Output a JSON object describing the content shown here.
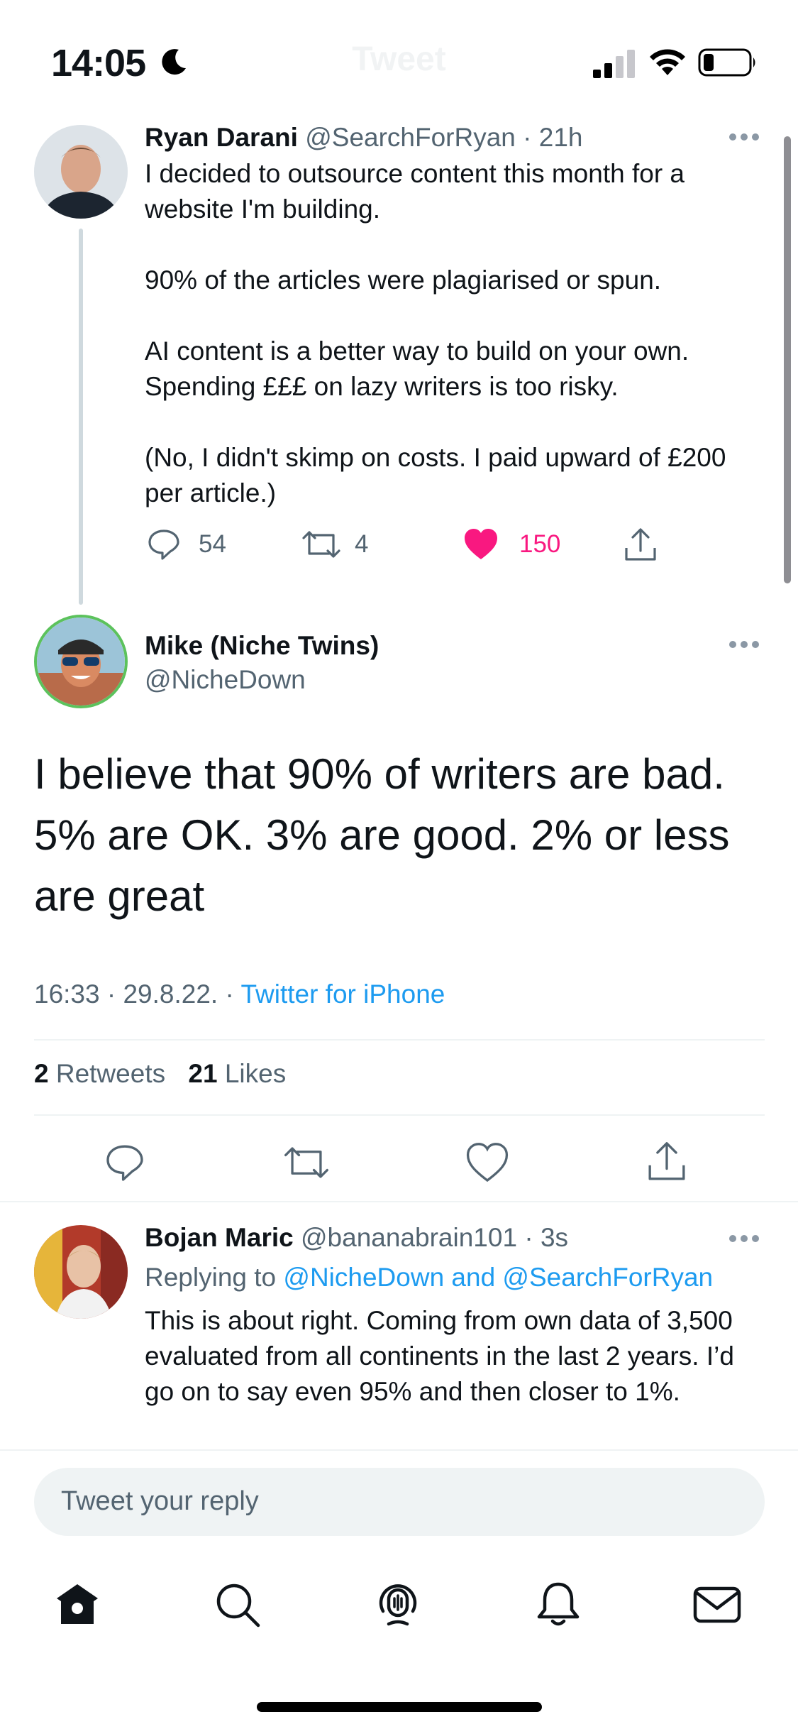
{
  "status_bar": {
    "time": "14:05",
    "ghost_title": "Tweet"
  },
  "icons": {
    "moon": "moon-icon",
    "signal": "cellular-signal-icon",
    "wifi": "wifi-icon",
    "battery": "battery-icon",
    "reply": "reply-icon",
    "retweet": "retweet-icon",
    "like": "heart-icon",
    "share": "share-icon",
    "more": "more-dots-icon"
  },
  "colors": {
    "accent": "#1d9bf0",
    "like": "#f91880",
    "text": "#0f1419",
    "secondary": "#536471"
  },
  "parent_tweet": {
    "name": "Ryan Darani",
    "handle": "@SearchForRyan",
    "time": "21h",
    "text": "I decided to outsource content this month for a website I'm building.\n\n90% of the articles were plagiarised or spun.\n\nAI content is a better way to build on your own. Spending £££ on lazy writers is too risky.\n\n(No, I didn't skimp on costs. I paid upward of £200 per article.)",
    "replies": "54",
    "retweets": "4",
    "likes": "150"
  },
  "main_tweet": {
    "name": "Mike (Niche Twins)",
    "handle": "@NicheDown",
    "text": "I believe that 90% of writers are bad. 5% are OK. 3% are good. 2% or less are great",
    "timestamp": "16:33 · 29.8.22. ·",
    "source": "Twitter for iPhone",
    "retweet_count": "2",
    "retweet_label": "Retweets",
    "like_count": "21",
    "like_label": "Likes"
  },
  "reply_tweet": {
    "name": "Bojan Maric",
    "handle": "@bananabrain101",
    "time": "3s",
    "replying_prefix": "Replying to",
    "replying_to": "@NicheDown and @SearchForRyan",
    "text": "This is about right. Coming from own data of 3,500 evaluated from all continents in the last 2 years. I’d go on to say even 95% and then closer to 1%."
  },
  "compose": {
    "placeholder": "Tweet your reply"
  },
  "tab_bar": {
    "items": [
      "home-icon",
      "search-icon",
      "spaces-icon",
      "notifications-icon",
      "messages-icon"
    ]
  }
}
